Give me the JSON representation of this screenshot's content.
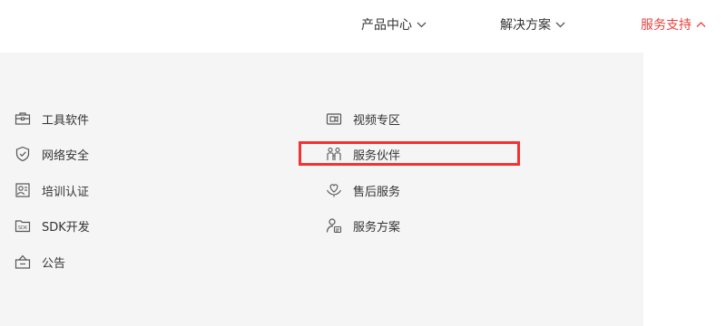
{
  "nav": {
    "products": "产品中心",
    "solutions": "解决方案",
    "support": "服务支持"
  },
  "menu": {
    "left": [
      {
        "label": "工具软件",
        "icon": "toolbox-icon"
      },
      {
        "label": "网络安全",
        "icon": "shield-icon"
      },
      {
        "label": "培训认证",
        "icon": "certificate-icon"
      },
      {
        "label": "SDK开发",
        "icon": "sdk-icon"
      },
      {
        "label": "公告",
        "icon": "announcement-icon"
      }
    ],
    "right": [
      {
        "label": "视频专区",
        "icon": "video-camera-icon"
      },
      {
        "label": "服务伙伴",
        "icon": "partners-icon"
      },
      {
        "label": "售后服务",
        "icon": "heart-hands-icon"
      },
      {
        "label": "服务方案",
        "icon": "user-plan-icon"
      }
    ]
  },
  "colors": {
    "accent": "#e8413c",
    "highlight_box": "#f53131",
    "panel_bg": "#f5f5f5"
  }
}
